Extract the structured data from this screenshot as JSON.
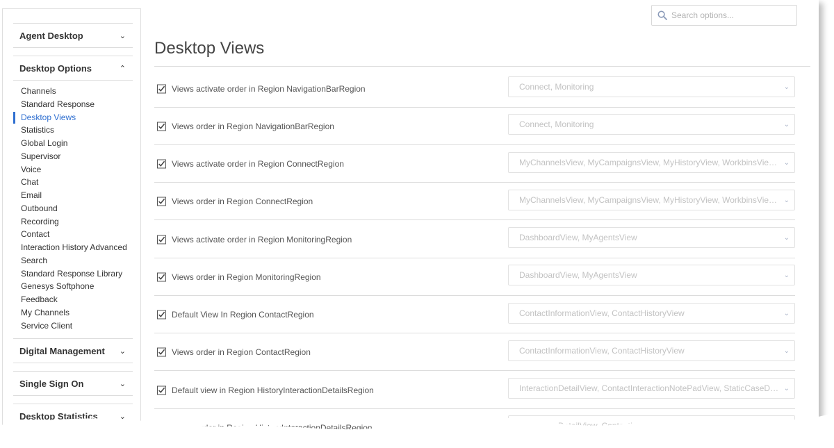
{
  "search": {
    "placeholder": "Search options..."
  },
  "sidebar": {
    "sections": [
      {
        "title": "Agent Desktop",
        "chevron": "chevron-down-icon"
      },
      {
        "title": "Desktop Options",
        "chevron": "chevron-up-icon"
      },
      {
        "title": "Digital Management",
        "chevron": "chevron-down-icon"
      },
      {
        "title": "Single Sign On",
        "chevron": "chevron-down-icon"
      },
      {
        "title": "Desktop Statistics",
        "chevron": "chevron-down-icon"
      }
    ],
    "items": [
      "Channels",
      "Standard Response",
      "Desktop Views",
      "Statistics",
      "Global Login",
      "Supervisor",
      "Voice",
      "Chat",
      "Email",
      "Outbound",
      "Recording",
      "Contact",
      "Interaction History Advanced",
      "Search",
      "Standard Response Library",
      "Genesys Softphone",
      "Feedback",
      "My Channels",
      "Service Client"
    ],
    "active_item": "Desktop Views"
  },
  "main": {
    "title": "Desktop Views",
    "options": [
      {
        "label": "Views activate order in Region NavigationBarRegion",
        "value": "Connect, Monitoring",
        "checked": true
      },
      {
        "label": "Views order in Region NavigationBarRegion",
        "value": "Connect, Monitoring",
        "checked": true
      },
      {
        "label": "Views activate order in Region ConnectRegion",
        "value": "MyChannelsView, MyCampaignsView, MyHistoryView, WorkbinsView, InteractionSearchView",
        "checked": true
      },
      {
        "label": "Views order in Region ConnectRegion",
        "value": "MyChannelsView, MyCampaignsView, MyHistoryView, WorkbinsView, InteractionSearchView",
        "checked": true
      },
      {
        "label": "Views activate order in Region MonitoringRegion",
        "value": "DashboardView, MyAgentsView",
        "checked": true
      },
      {
        "label": "Views order in Region MonitoringRegion",
        "value": "DashboardView, MyAgentsView",
        "checked": true
      },
      {
        "label": "Default View In Region ContactRegion",
        "value": "ContactInformationView, ContactHistoryView",
        "checked": true
      },
      {
        "label": "Views order in Region ContactRegion",
        "value": "ContactInformationView, ContactHistoryView",
        "checked": true
      },
      {
        "label": "Default view in Region HistoryInteractionDetailsRegion",
        "value": "InteractionDetailView, ContactInteractionNotePadView, StaticCaseDataView",
        "checked": true
      },
      {
        "label": "Views order in Region HistoryInteractionDetailsRegion",
        "value": "InteractionDetailView, ContactInteractionNotePadView, StaticCaseDataView",
        "checked": true
      }
    ]
  },
  "colors": {
    "accent": "#2f6fd0",
    "placeholder_text": "#c3c3c3"
  }
}
